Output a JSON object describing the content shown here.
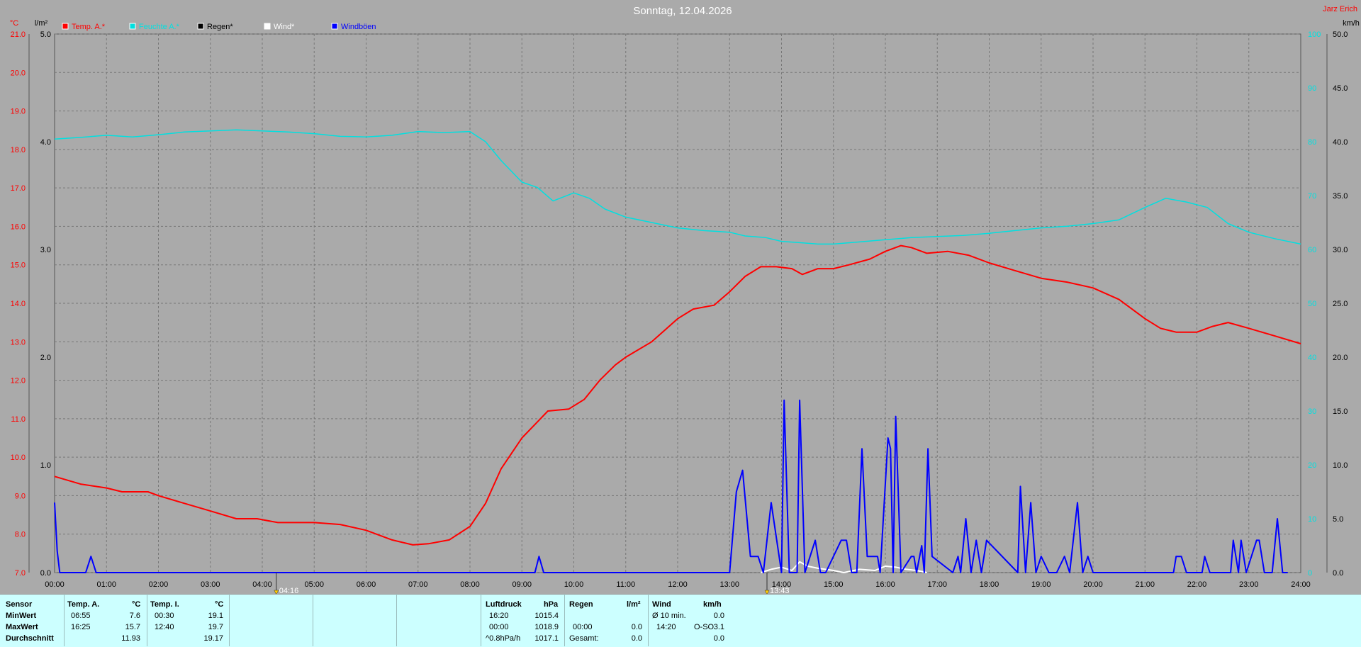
{
  "header": {
    "title": "Sonntag, 12.04.2026",
    "owner": "Jarz Erich"
  },
  "units": {
    "temp": "°C",
    "rain": "l/m²",
    "wind": "km/h"
  },
  "legend": [
    {
      "label": "Temp. A.*",
      "color": "#ff0000"
    },
    {
      "label": "Feuchte A.*",
      "color": "#00e0e0"
    },
    {
      "label": "Regen*",
      "color": "#000000"
    },
    {
      "label": "Wind*",
      "color": "#ffffff"
    },
    {
      "label": "Windböen",
      "color": "#0000ff"
    }
  ],
  "markers": [
    {
      "label": "04:16",
      "hour": 4.27
    },
    {
      "label": "13:43",
      "hour": 13.72
    }
  ],
  "chart_data": {
    "type": "line",
    "xlabel": "",
    "x_ticks": [
      "00:00",
      "01:00",
      "02:00",
      "03:00",
      "04:00",
      "05:00",
      "06:00",
      "07:00",
      "08:00",
      "09:00",
      "10:00",
      "11:00",
      "12:00",
      "13:00",
      "14:00",
      "15:00",
      "16:00",
      "17:00",
      "18:00",
      "19:00",
      "20:00",
      "21:00",
      "22:00",
      "23:00",
      "24:00"
    ],
    "x_range": [
      0,
      24
    ],
    "temp_axis": {
      "label": "°C",
      "range": [
        7.0,
        21.0
      ],
      "ticks": [
        "7.0",
        "8.0",
        "9.0",
        "10.0",
        "11.0",
        "12.0",
        "13.0",
        "14.0",
        "15.0",
        "16.0",
        "17.0",
        "18.0",
        "19.0",
        "20.0",
        "21.0"
      ]
    },
    "rain_axis": {
      "label": "l/m²",
      "range": [
        0.0,
        5.0
      ],
      "ticks": [
        "0.0",
        "1.0",
        "2.0",
        "3.0",
        "4.0",
        "5.0"
      ]
    },
    "hum_axis": {
      "range": [
        0,
        100
      ],
      "ticks": [
        "0",
        "10",
        "20",
        "30",
        "40",
        "50",
        "60",
        "70",
        "80",
        "90",
        "100"
      ]
    },
    "wind_axis": {
      "label": "km/h",
      "range": [
        0.0,
        50.0
      ],
      "ticks": [
        "0.0",
        "5.0",
        "10.0",
        "15.0",
        "20.0",
        "25.0",
        "30.0",
        "35.0",
        "40.0",
        "45.0",
        "50.0"
      ]
    },
    "series": [
      {
        "name": "Temp. A.*",
        "color": "#ff0000",
        "axis": "temp",
        "x": [
          0,
          0.5,
          1,
          1.3,
          1.8,
          2,
          2.5,
          3,
          3.5,
          3.9,
          4.3,
          4.7,
          5,
          5.5,
          6,
          6.5,
          6.9,
          7.2,
          7.6,
          8,
          8.3,
          8.6,
          9,
          9.5,
          9.9,
          10.2,
          10.5,
          10.8,
          11,
          11.5,
          12,
          12.3,
          12.7,
          13,
          13.3,
          13.6,
          13.9,
          14.2,
          14.4,
          14.7,
          15,
          15.3,
          15.7,
          16,
          16.3,
          16.5,
          16.8,
          17.2,
          17.6,
          18,
          18.5,
          19,
          19.5,
          20,
          20.5,
          21,
          21.3,
          21.6,
          22,
          22.3,
          22.6,
          23,
          23.5,
          24
        ],
        "y": [
          9.5,
          9.3,
          9.2,
          9.1,
          9.1,
          9.0,
          8.8,
          8.6,
          8.4,
          8.4,
          8.3,
          8.3,
          8.3,
          8.25,
          8.1,
          7.85,
          7.72,
          7.75,
          7.85,
          8.2,
          8.8,
          9.7,
          10.5,
          11.2,
          11.25,
          11.5,
          12.0,
          12.4,
          12.6,
          13.0,
          13.6,
          13.85,
          13.95,
          14.3,
          14.7,
          14.95,
          14.95,
          14.9,
          14.75,
          14.9,
          14.9,
          15.0,
          15.15,
          15.35,
          15.5,
          15.45,
          15.3,
          15.35,
          15.25,
          15.05,
          14.85,
          14.65,
          14.55,
          14.4,
          14.1,
          13.6,
          13.35,
          13.25,
          13.25,
          13.4,
          13.5,
          13.35,
          13.15,
          12.95
        ]
      },
      {
        "name": "Feuchte A.*",
        "color": "#00e0e0",
        "axis": "hum",
        "x": [
          0,
          0.5,
          1,
          1.5,
          2,
          2.5,
          3,
          3.5,
          4,
          4.5,
          5,
          5.5,
          6,
          6.5,
          7,
          7.5,
          8,
          8.3,
          8.6,
          9,
          9.3,
          9.6,
          10,
          10.3,
          10.6,
          11,
          11.5,
          12,
          12.5,
          13,
          13.3,
          13.7,
          14,
          14.3,
          14.7,
          15,
          15.5,
          16,
          16.5,
          17,
          17.5,
          18,
          18.5,
          19,
          19.5,
          20,
          20.5,
          21,
          21.4,
          21.8,
          22.2,
          22.6,
          23,
          23.5,
          24
        ],
        "y": [
          80.5,
          80.8,
          81.2,
          80.9,
          81.3,
          81.8,
          82.0,
          82.2,
          82.0,
          81.8,
          81.5,
          81.0,
          80.9,
          81.2,
          81.9,
          81.7,
          81.9,
          80.0,
          76.5,
          72.5,
          71.5,
          69.0,
          70.5,
          69.5,
          67.5,
          66.0,
          65.0,
          64.0,
          63.5,
          63.2,
          62.5,
          62.2,
          61.5,
          61.3,
          61.0,
          61.0,
          61.4,
          61.8,
          62.2,
          62.4,
          62.6,
          63.0,
          63.5,
          64.0,
          64.3,
          64.8,
          65.5,
          67.8,
          69.5,
          68.8,
          67.8,
          64.8,
          63.2,
          62.0,
          61.0
        ]
      },
      {
        "name": "Wind*",
        "color": "#ffffff",
        "axis": "wind",
        "x": [
          13.6,
          13.8,
          14.0,
          14.2,
          14.35,
          14.5,
          14.7,
          15.0,
          15.2,
          15.5,
          15.8,
          16.0,
          16.2,
          16.4,
          16.6,
          16.8
        ],
        "y": [
          0,
          0.3,
          0.5,
          0.2,
          1.0,
          0.6,
          0.4,
          0.2,
          0.0,
          0.3,
          0.2,
          0.6,
          0.5,
          0.3,
          0.2,
          0.0
        ]
      },
      {
        "name": "Windböen",
        "color": "#0000ff",
        "axis": "wind",
        "x": [
          0,
          0.05,
          0.1,
          0.6,
          0.7,
          0.8,
          9.25,
          9.33,
          9.42,
          13.0,
          13.13,
          13.25,
          13.4,
          13.55,
          13.65,
          13.8,
          14.0,
          14.05,
          14.15,
          14.3,
          14.35,
          14.45,
          14.65,
          14.75,
          14.85,
          15.15,
          15.25,
          15.35,
          15.45,
          15.55,
          15.65,
          15.85,
          15.9,
          16.05,
          16.1,
          16.15,
          16.2,
          16.3,
          16.5,
          16.55,
          16.6,
          16.7,
          16.75,
          16.82,
          16.9,
          17.3,
          17.4,
          17.45,
          17.55,
          17.65,
          17.75,
          17.85,
          17.95,
          18.55,
          18.6,
          18.7,
          18.8,
          18.9,
          19.0,
          19.15,
          19.3,
          19.45,
          19.55,
          19.7,
          19.8,
          19.9,
          20.0,
          20.1,
          20.2,
          21.55,
          21.6,
          21.7,
          21.8,
          22.1,
          22.15,
          22.25,
          22.65,
          22.7,
          22.8,
          22.85,
          22.95,
          23.15,
          23.2,
          23.3,
          23.45,
          23.55,
          23.65,
          23.75
        ],
        "y": [
          6.5,
          2.0,
          0,
          0,
          1.5,
          0,
          0,
          1.5,
          0,
          0,
          7.5,
          9.5,
          1.5,
          1.5,
          0,
          6.5,
          0,
          16.0,
          0,
          0,
          16.0,
          0,
          3.0,
          0,
          0,
          3.0,
          3.0,
          0,
          0,
          11.5,
          1.5,
          1.5,
          0,
          12.5,
          11.5,
          0,
          14.5,
          0,
          1.5,
          1.5,
          0,
          2.5,
          0,
          11.5,
          1.5,
          0,
          1.5,
          0,
          5.0,
          0,
          3.0,
          0,
          3.0,
          0,
          8.0,
          0,
          6.5,
          0,
          1.5,
          0,
          0,
          1.5,
          0,
          6.5,
          0,
          1.5,
          0,
          0,
          0,
          0,
          1.5,
          1.5,
          0,
          0,
          1.5,
          0,
          0,
          3.0,
          0,
          3.0,
          0,
          3.0,
          3.0,
          0,
          0,
          5.0,
          0,
          0
        ]
      }
    ]
  },
  "stats": {
    "row_labels": [
      "Sensor",
      "MinWert",
      "MaxWert",
      "Durchschnitt"
    ],
    "temp_a": {
      "header": "Temp. A.",
      "unit": "°C",
      "min_time": "06:55",
      "min_val": "7.6",
      "max_time": "16:25",
      "max_val": "15.7",
      "avg": "11.93"
    },
    "temp_i": {
      "header": "Temp. I.",
      "unit": "°C",
      "min_time": "00:30",
      "min_val": "19.1",
      "max_time": "12:40",
      "max_val": "19.7",
      "avg": "19.17"
    },
    "pressure": {
      "header": "Luftdruck",
      "unit": "hPa",
      "min_time": "16:20",
      "min_val": "1015.4",
      "max_time": "00:00",
      "max_val": "1018.9",
      "trend_label": "^0.8hPa/h",
      "avg": "1017.1"
    },
    "rain": {
      "header": "Regen",
      "unit": "l/m²",
      "max_time": "00:00",
      "max_val": "0.0",
      "total_label": "Gesamt:",
      "total": "0.0"
    },
    "wind": {
      "header": "Wind",
      "unit": "km/h",
      "avg_label": "Ø 10 min.",
      "avg_val": "0.0",
      "max_time": "14:20",
      "max_dir": "O-SO",
      "max_val": "3.1",
      "avg2": "0.0"
    }
  }
}
